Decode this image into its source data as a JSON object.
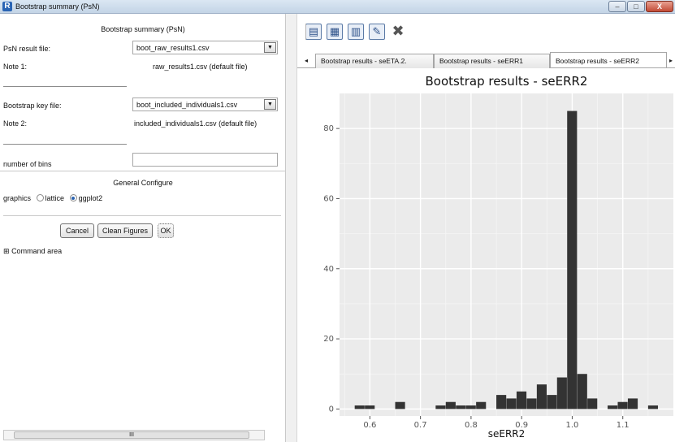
{
  "window": {
    "title": "Bootstrap summary (PsN)",
    "app_letter": "R",
    "minimize": "–",
    "maximize": "□",
    "close": "X"
  },
  "form": {
    "heading": "Bootstrap summary (PsN)",
    "psn_label": "PsN result file:",
    "psn_value": "boot_raw_results1.csv",
    "note1_label": "Note 1:",
    "note1_text": "raw_results1.csv (default file)",
    "key_label": "Bootstrap key file:",
    "key_value": "boot_included_individuals1.csv",
    "note2_label": "Note 2:",
    "note2_text": "included_individuals1.csv (default file)",
    "bins_label": "number of bins",
    "bins_value": "",
    "general_heading": "General Configure",
    "graphics_label": "graphics",
    "graphics_options": [
      "lattice",
      "ggplot2"
    ],
    "graphics_selected": "ggplot2",
    "cancel": "Cancel",
    "clean": "Clean Figures",
    "ok": "OK",
    "command_area": "Command area",
    "expand_glyph": "⊞",
    "combo_glyph": "▼",
    "scroll_thumb": "III"
  },
  "toolbar": {
    "icons": [
      "save-icon",
      "chart-image-icon",
      "grid-icon",
      "edit-icon",
      "close-x-icon"
    ]
  },
  "tabs": {
    "items": [
      "Bootstrap results - seETA.2.",
      "Bootstrap results - seERR1",
      "Bootstrap results - seERR2"
    ],
    "active": 2,
    "left_arrow": "◂",
    "right_arrow": "▸"
  },
  "chart_data": {
    "type": "bar",
    "title": "Bootstrap results - seERR2",
    "xlabel": "seERR2",
    "ylabel": "",
    "bin_width": 0.02,
    "x_bin_starts": [
      0.57,
      0.59,
      0.65,
      0.73,
      0.75,
      0.77,
      0.79,
      0.81,
      0.85,
      0.87,
      0.89,
      0.91,
      0.93,
      0.95,
      0.97,
      0.99,
      1.01,
      1.03,
      1.07,
      1.09,
      1.11,
      1.15
    ],
    "values": [
      1,
      1,
      2,
      1,
      2,
      1,
      1,
      2,
      4,
      3,
      5,
      3,
      7,
      4,
      9,
      85,
      10,
      3,
      1,
      2,
      3,
      1
    ],
    "xlim": [
      0.54,
      1.2
    ],
    "ylim": [
      -2,
      90
    ],
    "x_ticks": [
      "0.6",
      "0.7",
      "0.8",
      "0.9",
      "1.0",
      "1.1"
    ],
    "y_ticks": [
      "0",
      "20",
      "40",
      "60",
      "80"
    ],
    "background": "#ebebeb",
    "bar_color": "#333333",
    "grid": true
  }
}
